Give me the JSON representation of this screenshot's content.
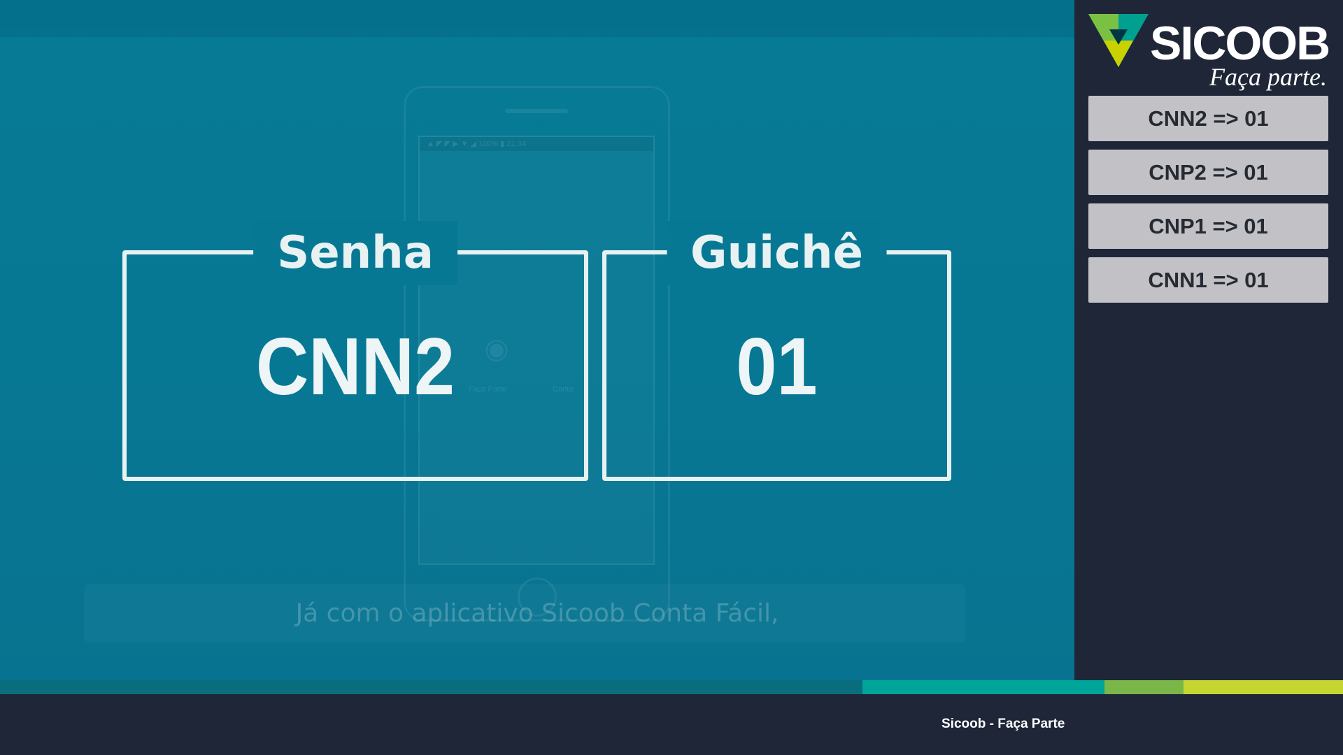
{
  "ticket": {
    "senha_label": "Senha",
    "senha_value": "CNN2",
    "guiche_label": "Guichê",
    "guiche_value": "01"
  },
  "background": {
    "caption": "Já com o aplicativo Sicoob Conta Fácil,",
    "phone_status": "▲ ◤ ◤ ▶                          ▼ ◢ 100% ▮ 21:34",
    "icon_camera": "◉",
    "phone_app_label_1": "Faça Parte",
    "phone_app_label_2": "Conta"
  },
  "brand": {
    "name": "SICOOB",
    "tagline": "Faça parte.",
    "colors": {
      "logo_green": "#7ac143",
      "logo_yellow": "#c9d200",
      "logo_teal": "#00a091",
      "logo_dark": "#003641"
    }
  },
  "history": {
    "items": [
      "CNN2 => 01",
      "CNP2 => 01",
      "CNP1 => 01",
      "CNN1 => 01"
    ]
  },
  "strip": {
    "colors": [
      "#0a6d7e",
      "#00a59a",
      "#7ab648",
      "#c6d631"
    ]
  },
  "footer": {
    "text": "Sicoob - Faça Parte"
  }
}
